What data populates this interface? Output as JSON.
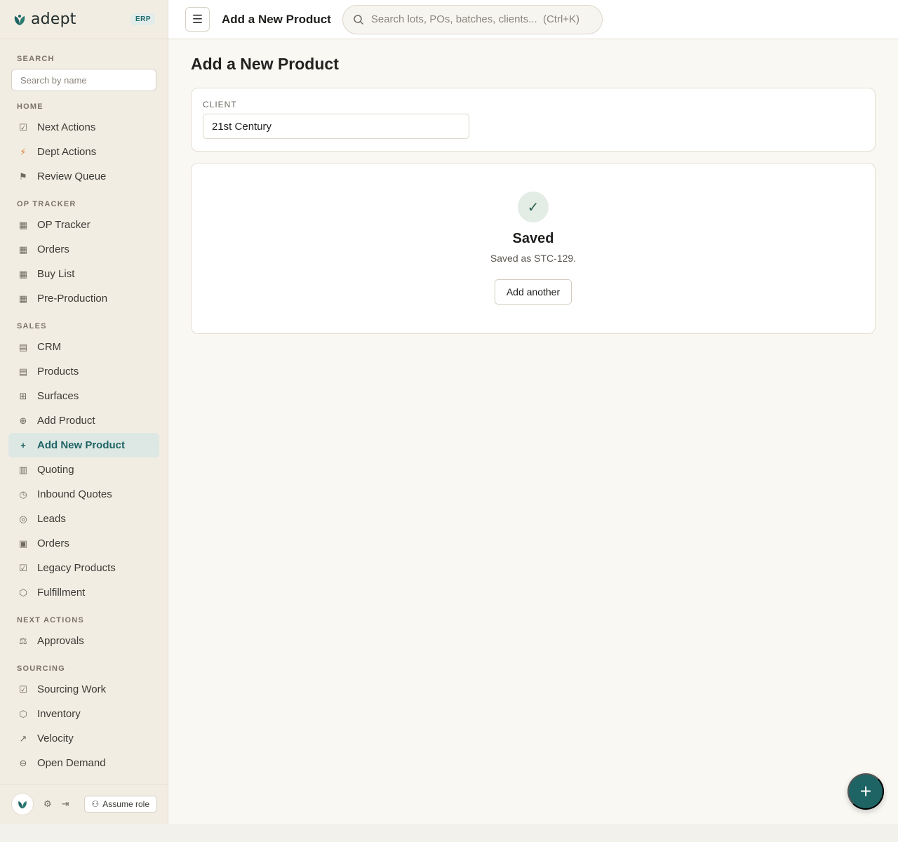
{
  "brand": {
    "name": "adept",
    "badge": "ERP"
  },
  "sidebar": {
    "search": {
      "title": "SEARCH",
      "placeholder": "Search by name"
    },
    "sections": [
      {
        "title": "HOME",
        "items": [
          {
            "label": "Next Actions",
            "icon": "check-square-icon"
          },
          {
            "label": "Dept Actions",
            "icon": "bolt-icon"
          },
          {
            "label": "Review Queue",
            "icon": "flag-icon"
          }
        ]
      },
      {
        "title": "OP TRACKER",
        "items": [
          {
            "label": "OP Tracker",
            "icon": "grid-icon"
          },
          {
            "label": "Orders",
            "icon": "grid-icon"
          },
          {
            "label": "Buy List",
            "icon": "grid-icon"
          },
          {
            "label": "Pre-Production",
            "icon": "grid-icon"
          }
        ]
      },
      {
        "title": "SALES",
        "items": [
          {
            "label": "CRM",
            "icon": "id-card-icon"
          },
          {
            "label": "Products",
            "icon": "list-icon"
          },
          {
            "label": "Surfaces",
            "icon": "table-icon"
          },
          {
            "label": "Add Product",
            "icon": "plus-circle-icon"
          },
          {
            "label": "Add New Product",
            "icon": "plus-icon",
            "active": true
          },
          {
            "label": "Quoting",
            "icon": "calculator-icon"
          },
          {
            "label": "Inbound Quotes",
            "icon": "clock-icon"
          },
          {
            "label": "Leads",
            "icon": "target-icon"
          },
          {
            "label": "Orders",
            "icon": "clipboard-icon"
          },
          {
            "label": "Legacy Products",
            "icon": "checkbox-icon"
          },
          {
            "label": "Fulfillment",
            "icon": "package-icon"
          }
        ]
      },
      {
        "title": "NEXT ACTIONS",
        "items": [
          {
            "label": "Approvals",
            "icon": "scale-icon"
          }
        ]
      },
      {
        "title": "SOURCING",
        "items": [
          {
            "label": "Sourcing Work",
            "icon": "checkbox-icon"
          },
          {
            "label": "Inventory",
            "icon": "box-icon"
          },
          {
            "label": "Velocity",
            "icon": "trend-icon"
          },
          {
            "label": "Open Demand",
            "icon": "minus-circle-icon"
          }
        ]
      }
    ],
    "footer": {
      "assume_role": "Assume role"
    }
  },
  "topbar": {
    "title": "Add a New Product",
    "search_placeholder": "Search lots, POs, batches, clients...  (Ctrl+K)"
  },
  "main": {
    "title": "Add a New Product",
    "client": {
      "label": "CLIENT",
      "value": "21st Century"
    },
    "saved": {
      "title": "Saved",
      "message": "Saved as STC-129.",
      "button": "Add another"
    }
  },
  "colors": {
    "accent": "#1f6464",
    "active_bg": "#dde8e4",
    "bolt": "#e07a3a"
  }
}
